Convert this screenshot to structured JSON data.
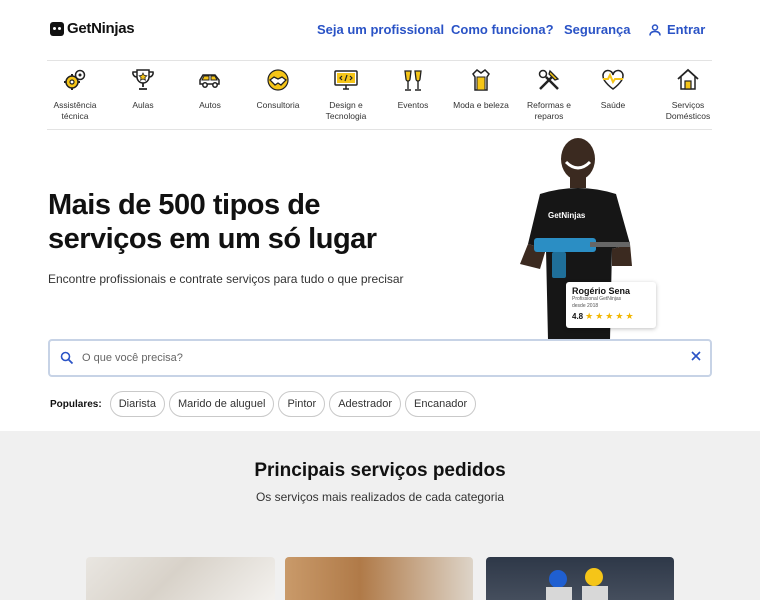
{
  "header": {
    "logo_text": "GetNinjas",
    "nav": [
      "Seja um profissional",
      "Como funciona?",
      "Segurança"
    ],
    "login_label": "Entrar"
  },
  "categories": [
    {
      "label": "Assistência técnica",
      "icon": "gears-icon"
    },
    {
      "label": "Aulas",
      "icon": "trophy-icon"
    },
    {
      "label": "Autos",
      "icon": "car-icon"
    },
    {
      "label": "Consultoria",
      "icon": "handshake-icon"
    },
    {
      "label": "Design e Tecnologia",
      "icon": "code-monitor-icon"
    },
    {
      "label": "Eventos",
      "icon": "champagne-icon"
    },
    {
      "label": "Moda e beleza",
      "icon": "dress-icon"
    },
    {
      "label": "Reformas e reparos",
      "icon": "tools-icon"
    },
    {
      "label": "Saúde",
      "icon": "heart-pulse-icon"
    },
    {
      "label": "Serviços Domésticos",
      "icon": "house-icon"
    }
  ],
  "hero": {
    "title": "Mais de 500 tipos de serviços em um só lugar",
    "subtitle": "Encontre profissionais e contrate serviços para tudo o que precisar",
    "shirt_text": "GetNinjas",
    "badge": {
      "name": "Rogério Sena",
      "line1": "Profissional GetNinjas",
      "line2": "desde 2018",
      "rating": "4.8",
      "stars": 5
    }
  },
  "search": {
    "placeholder": "O que você precisa?",
    "value": ""
  },
  "popular": {
    "label": "Populares:",
    "items": [
      "Diarista",
      "Marido de aluguel",
      "Pintor",
      "Adestrador",
      "Encanador"
    ]
  },
  "services": {
    "title": "Principais serviços pedidos",
    "subtitle": "Os serviços mais realizados de cada categoria"
  },
  "colors": {
    "accent": "#2a53c6",
    "icon_yellow": "#f5c518",
    "section_bg": "#f0f0f0"
  }
}
